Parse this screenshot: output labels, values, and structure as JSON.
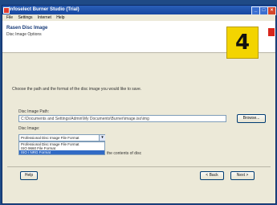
{
  "window": {
    "title": "Infoselect Burner Studio (Trial)",
    "controls": [
      "_",
      "□",
      "×"
    ]
  },
  "menu": [
    "File",
    "Settings",
    "Internet",
    "Help"
  ],
  "banner": {
    "title": "Rasen Disc Image",
    "subtitle": "Disc Image Options"
  },
  "badge": "4",
  "instruction": "Choose the path and the format of the disc image you would like to save.",
  "path_field": {
    "label": "Disc Image Path:",
    "value": "C:\\Documents and Settings\\Admin\\My Documents\\Burner\\image.iso\\img"
  },
  "browse_label": "Browse...",
  "format": {
    "label": "Disc Image:",
    "selected": "Professional Disc Image File Format",
    "options": [
      "Professional Disc Image File Format",
      "ISO 9660 File Format",
      "ISO / NRG Format"
    ],
    "highlighted_index": 2,
    "hint": "the contents of disc"
  },
  "footer": {
    "help": "Help",
    "back": "< Back",
    "next": "Next >"
  }
}
